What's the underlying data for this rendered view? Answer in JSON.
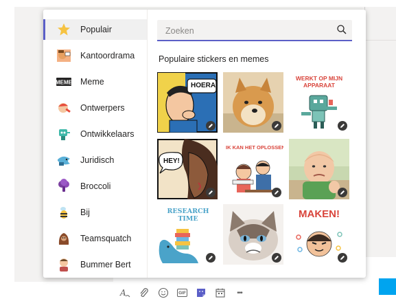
{
  "sidebar": {
    "items": [
      {
        "label": "Populair",
        "icon": "star-icon"
      },
      {
        "label": "Kantoordrama",
        "icon": "kantoordrama-sticker-icon"
      },
      {
        "label": "Meme",
        "icon": "meme-icon"
      },
      {
        "label": "Ontwerpers",
        "icon": "ontwerpers-sticker-icon"
      },
      {
        "label": "Ontwikkelaars",
        "icon": "ontwikkelaars-sticker-icon"
      },
      {
        "label": "Juridisch",
        "icon": "juridisch-sticker-icon"
      },
      {
        "label": "Broccoli",
        "icon": "broccoli-sticker-icon"
      },
      {
        "label": "Bij",
        "icon": "bee-icon"
      },
      {
        "label": "Teamsquatch",
        "icon": "teamsquatch-icon"
      },
      {
        "label": "Bummer Bert",
        "icon": "bummer-bert-icon"
      }
    ],
    "active_index": 0
  },
  "search": {
    "placeholder": "Zoeken"
  },
  "section_title": "Populaire stickers en memes",
  "stickers": [
    {
      "name": "hoera-sticker",
      "caption": "HOERA!"
    },
    {
      "name": "doge-sticker",
      "caption": ""
    },
    {
      "name": "werkt-op-mijn-apparaat-sticker",
      "caption": "WERKT OP MIJN APPARAAT"
    },
    {
      "name": "hey-sticker",
      "caption": "HEY!"
    },
    {
      "name": "ik-kan-het-oplossen-sticker",
      "caption": "IK KAN HET OPLOSSEN"
    },
    {
      "name": "success-kid-sticker",
      "caption": ""
    },
    {
      "name": "research-time-sticker",
      "caption": "RESEARCH TIME"
    },
    {
      "name": "grumpy-cat-sticker",
      "caption": ""
    },
    {
      "name": "maken-sticker",
      "caption": "MAKEN!"
    }
  ],
  "toolbar": {
    "gif_label": "GIF",
    "more_label": "•••"
  },
  "colors": {
    "accent": "#5b5fc7",
    "send_button": "#00a4ef"
  }
}
